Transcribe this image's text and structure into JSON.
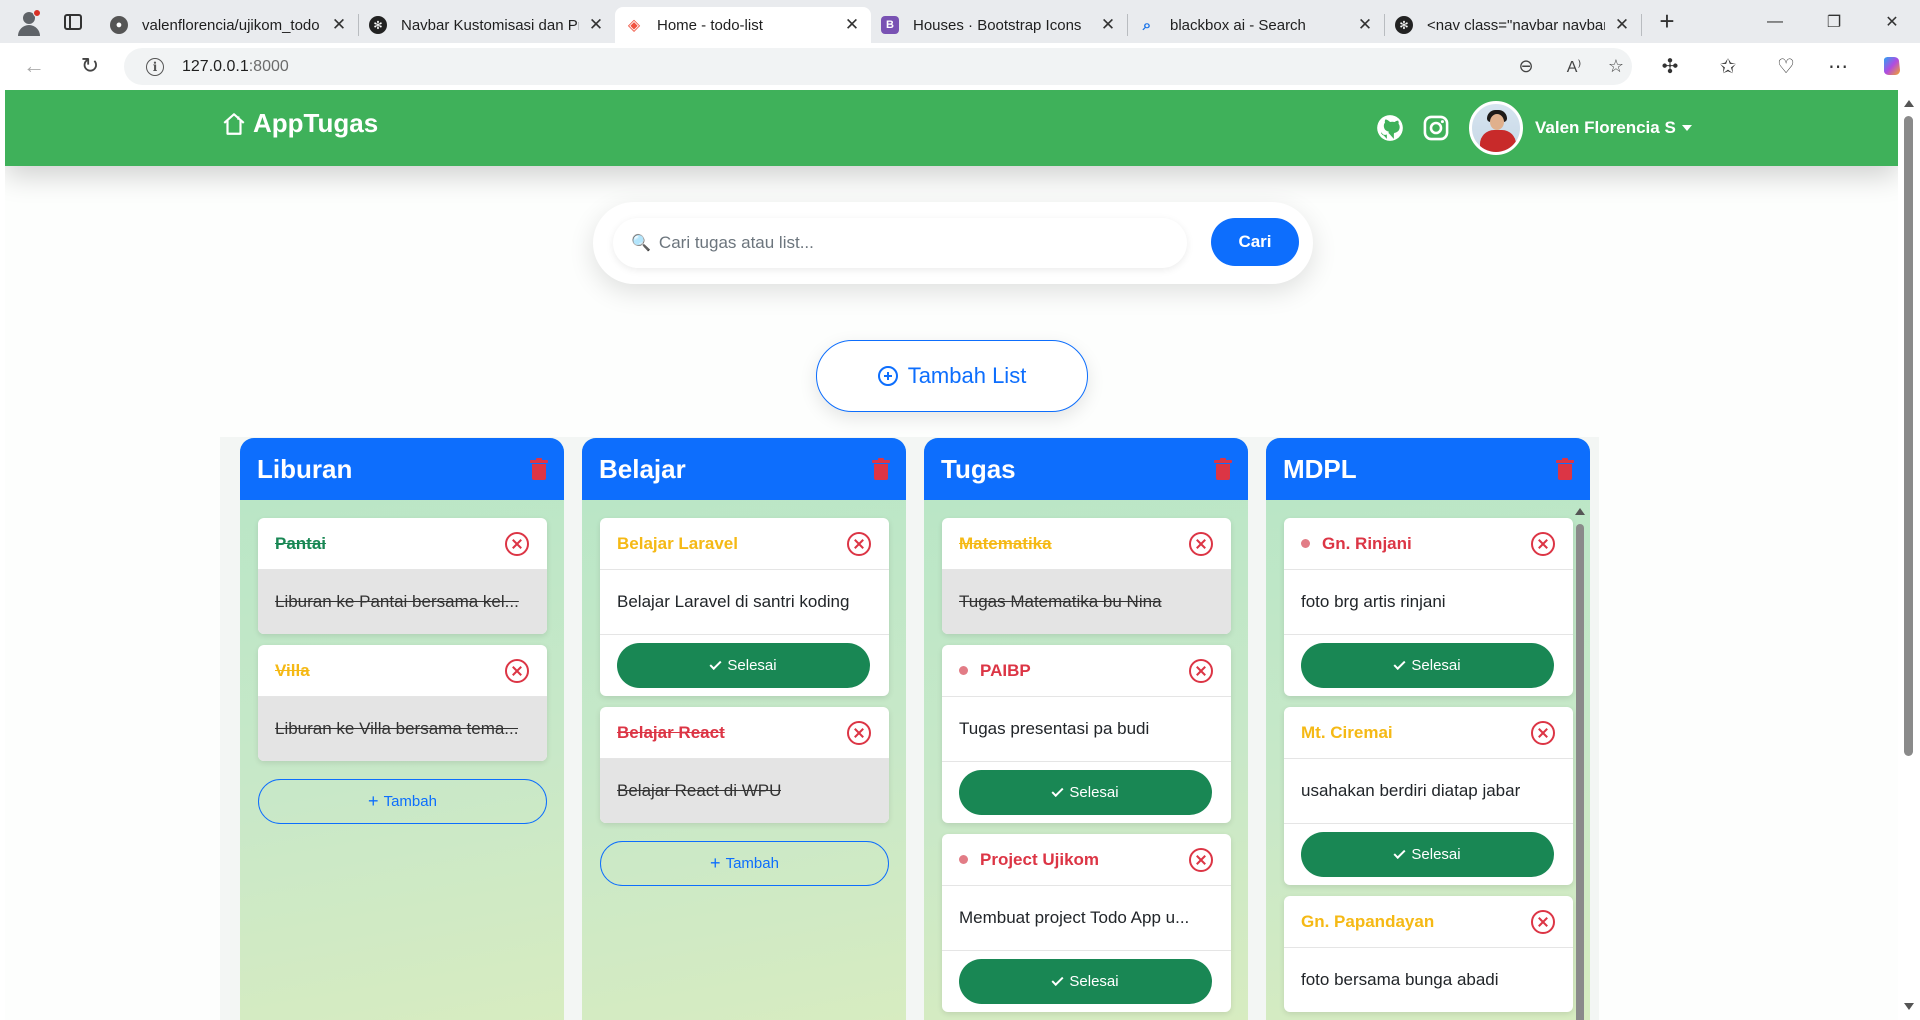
{
  "browser": {
    "tabs": [
      {
        "title": "valenflorencia/ujikom_todo",
        "icon": "github-icon",
        "favicon_color": "#555555"
      },
      {
        "title": "Navbar Kustomisasi dan Pro",
        "icon": "openai-icon",
        "favicon_color": "#222222"
      },
      {
        "title": "Home - todo-list",
        "icon": "laravel-icon",
        "favicon_color": "#f05340"
      },
      {
        "title": "Houses · Bootstrap Icons",
        "icon": "bootstrap-icon",
        "favicon_color": "#7952b3"
      },
      {
        "title": "blackbox ai - Search",
        "icon": "search-icon",
        "favicon_color": "#1a73e8"
      },
      {
        "title": "<nav class=\"navbar navbar",
        "icon": "openai-icon",
        "favicon_color": "#222222"
      }
    ],
    "active_tab_index": 2,
    "url_host": "127.0.0.1",
    "url_port": ":8000"
  },
  "app": {
    "brand": "AppTugas",
    "user_name": "Valen Florencia S",
    "search_placeholder": "Cari tugas atau list...",
    "search_button": "Cari",
    "add_list_button": "Tambah List",
    "colors": {
      "navbar": "#3fb15a",
      "primary": "#0d6efd",
      "success": "#198754",
      "danger": "#dc3545",
      "warning": "#f5b915"
    }
  },
  "columns": [
    {
      "title": "Liburan",
      "tasks": [
        {
          "name": "Pantai",
          "priority_color": "green",
          "done": true,
          "description": "Liburan ke Pantai bersama kel..."
        },
        {
          "name": "Villa",
          "priority_color": "yellow",
          "done": true,
          "description": "Liburan ke Villa bersama tema..."
        }
      ],
      "add_button": "Tambah"
    },
    {
      "title": "Belajar",
      "tasks": [
        {
          "name": "Belajar Laravel",
          "priority_color": "yellow",
          "done": false,
          "description": "Belajar Laravel di santri koding",
          "action": "Selesai"
        },
        {
          "name": "Belajar React",
          "priority_color": "red",
          "done": true,
          "description": "Belajar React di WPU"
        }
      ],
      "add_button": "Tambah"
    },
    {
      "title": "Tugas",
      "tasks": [
        {
          "name": "Matematika",
          "priority_color": "yellow",
          "done": true,
          "description": "Tugas Matematika bu Nina"
        },
        {
          "name": "PAIBP",
          "priority_color": "red",
          "done": false,
          "bullet": true,
          "description": "Tugas presentasi pa budi",
          "action": "Selesai"
        },
        {
          "name": "Project Ujikom",
          "priority_color": "red",
          "done": false,
          "bullet": true,
          "description": "Membuat project Todo App u...",
          "action": "Selesai"
        }
      ]
    },
    {
      "title": "MDPL",
      "tasks": [
        {
          "name": "Gn. Rinjani",
          "priority_color": "red",
          "done": false,
          "bullet": true,
          "description": "foto brg artis rinjani",
          "action": "Selesai"
        },
        {
          "name": "Mt. Ciremai",
          "priority_color": "yellow",
          "done": false,
          "description": "usahakan berdiri diatap jabar",
          "action": "Selesai"
        },
        {
          "name": "Gn. Papandayan",
          "priority_color": "yellow",
          "done": false,
          "description": "foto bersama bunga abadi"
        }
      ]
    }
  ]
}
